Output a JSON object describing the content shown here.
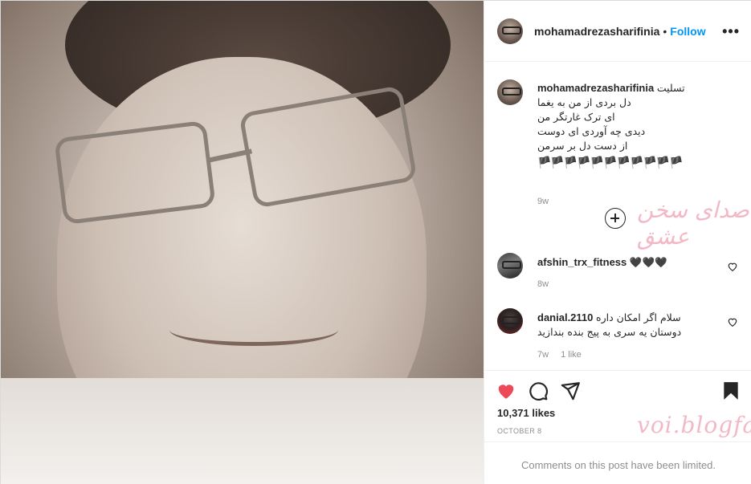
{
  "post": {
    "image_alt": "Black and white portrait photo of an older man wearing glasses"
  },
  "header": {
    "username": "mohamadrezasharifinia",
    "separator": "•",
    "follow_label": "Follow",
    "more_icon": "more-icon"
  },
  "caption": {
    "username": "mohamadrezasharifinia",
    "lines": [
      "تسلیت",
      "دل بردی از من به یغما",
      "ای ترک غارتگر من",
      "دیدی چه آوردی ای دوست",
      "از دست دل بر سرمن"
    ],
    "flags": "🏴🏴🏴🏴🏴🏴🏴🏴🏴🏴🏴",
    "time": "9w"
  },
  "watermark_top": "صدای سخن عشق",
  "load_more_icon": "plus-circle-icon",
  "comments": [
    {
      "username": "afshin_trx_fitness",
      "text": "🖤🖤🖤",
      "time": "8w",
      "likes": ""
    },
    {
      "username": "danial.2110",
      "text": "سلام اگر امکان داره دوستان یه سری به پیج بنده بندازید",
      "time": "7w",
      "likes": "1 like"
    }
  ],
  "actions": {
    "like_icon": "heart-filled-icon",
    "comment_icon": "comment-icon",
    "share_icon": "share-icon",
    "save_icon": "bookmark-filled-icon",
    "like_color": "#ed4956"
  },
  "likes_count": "10,371 likes",
  "date": "OCTOBER 8",
  "watermark_bottom": "voi.blogfa",
  "comments_limited": "Comments on this post have been limited.",
  "colors": {
    "link_blue": "#0095f6",
    "muted_gray": "#8e8e8e",
    "watermark_pink": "#f3b8c6"
  }
}
